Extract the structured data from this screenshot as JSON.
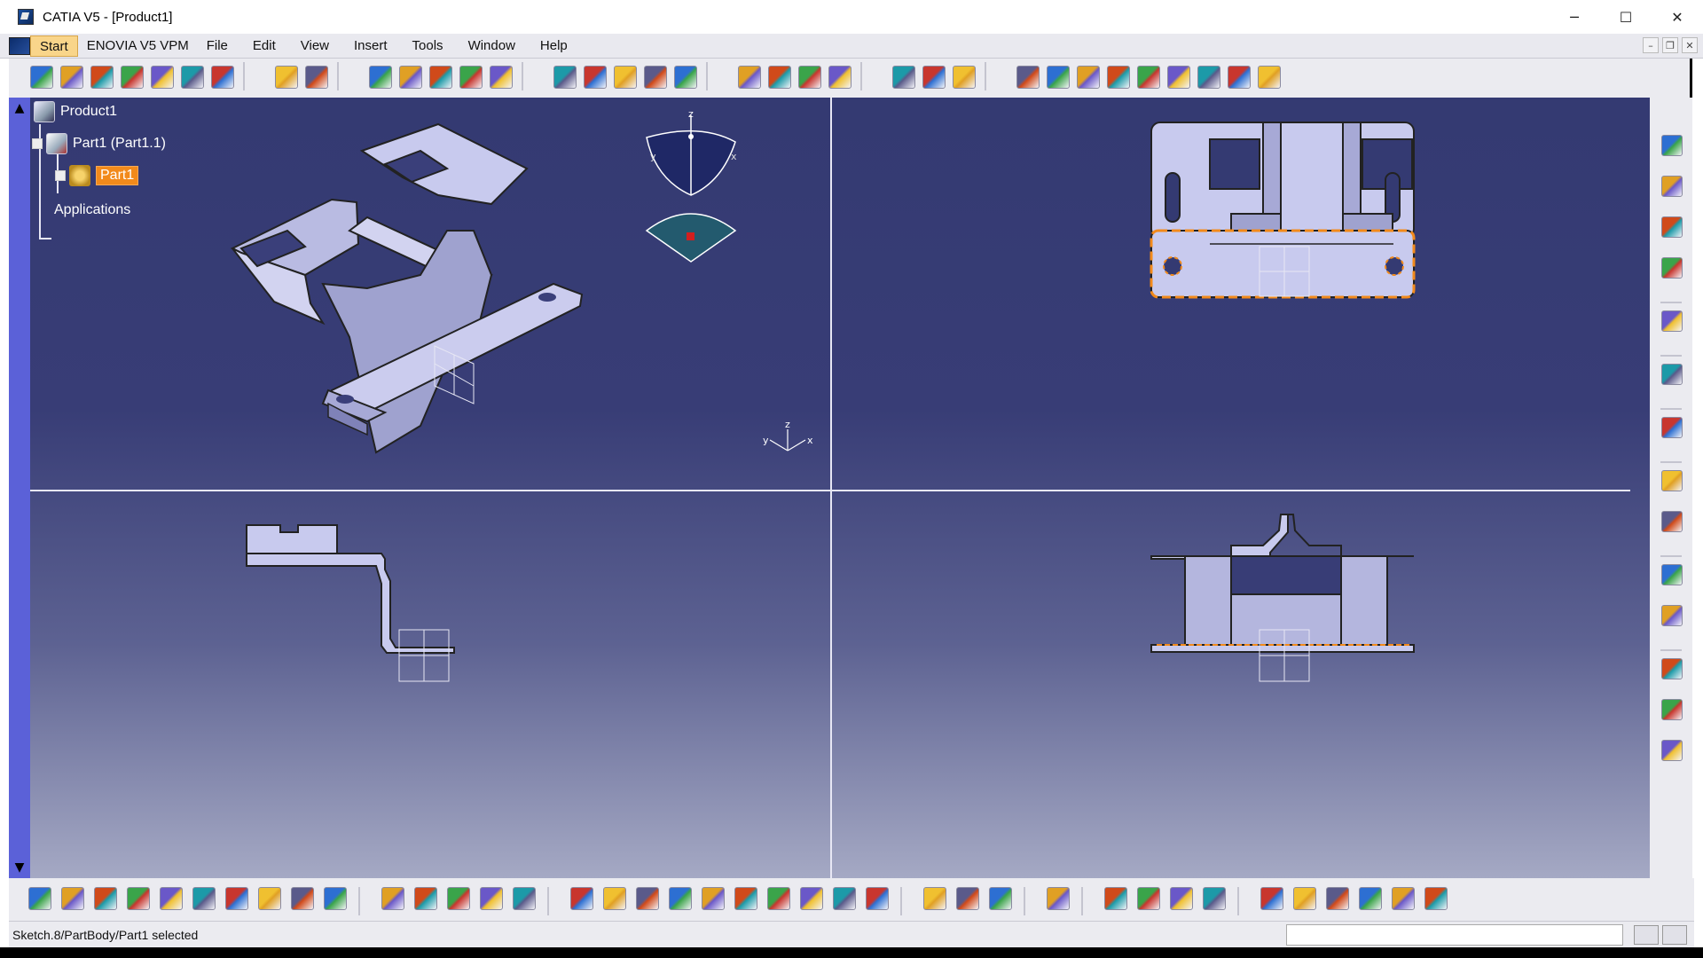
{
  "window": {
    "title": "CATIA V5 - [Product1]",
    "minimize_glyph": "─",
    "maximize_glyph": "☐",
    "close_glyph": "✕"
  },
  "menubar": {
    "items": [
      "Start",
      "ENOVIA V5 VPM",
      "File",
      "Edit",
      "View",
      "Insert",
      "Tools",
      "Window",
      "Help"
    ],
    "active": "Start",
    "mdi_minimize": "–",
    "mdi_restore": "❐",
    "mdi_close": "✕"
  },
  "tree": {
    "root": "Product1",
    "part_instance": "Part1 (Part1.1)",
    "part": "Part1",
    "applications": "Applications"
  },
  "compass": {
    "z_label": "z",
    "y_label": "y",
    "x_label": "x"
  },
  "axis_triad": {
    "z_label": "z",
    "y_label": "y",
    "x_label": "x"
  },
  "statusbar": {
    "message": "Sketch.8/PartBody/Part1 selected",
    "command_input": ""
  },
  "colors": {
    "viewport_top": "#343a72",
    "viewport_bottom": "#a5a9c4",
    "selection": "#f28a1b",
    "part_fill": "#c6c8ec",
    "left_strip": "#5b61d8"
  },
  "icons": {
    "top_toolbar": [
      "product-management-icon",
      "part-design-icon",
      "sketcher-icon",
      "assembly-icon",
      "constraint-icon",
      "knowledge-icon",
      "catalog-icon",
      "fit-all-icon",
      "what-is-this-icon",
      "analysis-icon",
      "wall-icon",
      "flange-icon",
      "hem-icon",
      "tear-drop-icon",
      "user-flange-icon",
      "stamp-icon",
      "pattern-icon",
      "bend-icon",
      "unfold-icon",
      "text-icon",
      "annotation-icon",
      "measure-icon",
      "view-mode-icon",
      "render-icon",
      "shading-icon",
      "material-icon",
      "section-icon",
      "top-view-icon",
      "front-view-icon",
      "right-view-icon",
      "iso-view-icon",
      "axis-icon",
      "origin-icon",
      "plane-icon",
      "point-icon"
    ],
    "right_toolbar": [
      "spec-tree-icon",
      "catalog-icon",
      "product-icon",
      "part-icon",
      "gear-icon",
      "select-arrow-icon",
      "sketch-icon",
      "camera-icon",
      "save-icon",
      "multi-view-icon",
      "viewpoint-icon",
      "point-icon",
      "line-icon",
      "plane-icon"
    ],
    "bottom_toolbar": [
      "new-icon",
      "open-icon",
      "save-icon",
      "print-icon",
      "cut-icon",
      "copy-icon",
      "paste-icon",
      "undo-icon",
      "redo-icon",
      "what-is-this-icon",
      "formula-icon",
      "comment-icon",
      "table-icon",
      "knowledge-icon",
      "measure-icon",
      "pan-icon",
      "fit-all-icon",
      "rotate-icon",
      "zoom-in-icon",
      "zoom-out-icon",
      "normal-view-icon",
      "quick-view-icon",
      "render-icon",
      "hide-show-icon",
      "swap-icon",
      "capture-icon",
      "measure-between-icon",
      "mass-icon",
      "camera-icon",
      "apply-material-icon",
      "lamp-icon",
      "catalog-icon",
      "update-icon",
      "compass-icon",
      "axis-icon",
      "dimension-icon",
      "fastener-icon",
      "tolerance-icon",
      "catia-logo-icon"
    ]
  }
}
